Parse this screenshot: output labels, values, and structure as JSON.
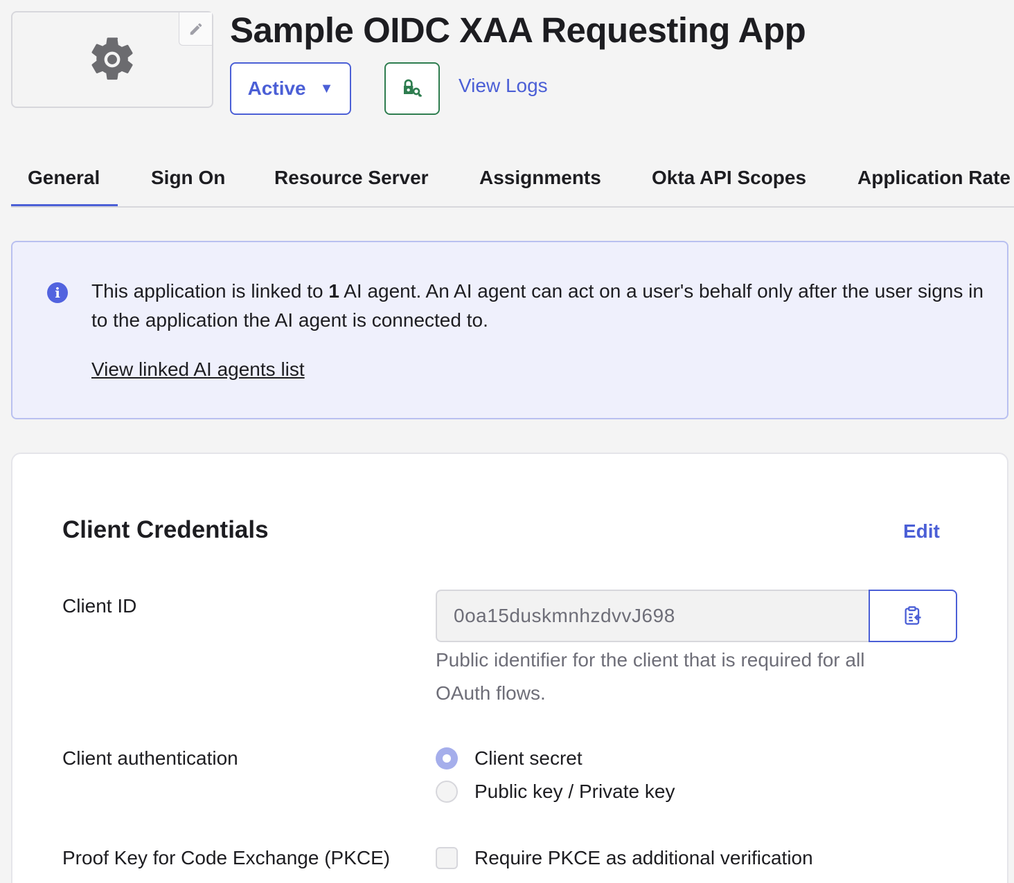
{
  "header": {
    "app_title": "Sample OIDC XAA Requesting App",
    "status_label": "Active",
    "status_caret": "▼",
    "view_logs": "View Logs",
    "logo_icon": "gear-icon",
    "edit_icon": "pencil-icon",
    "key_icon": "lock-key-icon"
  },
  "tabs": [
    {
      "label": "General",
      "active": true
    },
    {
      "label": "Sign On"
    },
    {
      "label": "Resource Server"
    },
    {
      "label": "Assignments"
    },
    {
      "label": "Okta API Scopes"
    },
    {
      "label": "Application Rate"
    }
  ],
  "banner": {
    "text_before": "This application is linked to ",
    "count": "1",
    "text_after": " AI agent. An AI agent can act on a user's behalf only after the user signs in to the application the AI agent is connected to.",
    "link": "View linked AI agents list",
    "icon": "info-icon"
  },
  "credentials": {
    "title": "Client Credentials",
    "edit": "Edit",
    "client_id_label": "Client ID",
    "client_id_value": "0oa15duskmnhzdvvJ698",
    "client_id_hint": "Public identifier for the client that is required for all OAuth flows.",
    "copy_icon": "clipboard-copy-icon",
    "auth_label": "Client authentication",
    "auth_options": [
      {
        "label": "Client secret",
        "selected": true
      },
      {
        "label": "Public key / Private key",
        "selected": false
      }
    ],
    "pkce_label": "Proof Key for Code Exchange (PKCE)",
    "pkce_option": "Require PKCE as additional verification",
    "pkce_checked": false
  },
  "colors": {
    "accent": "#4b5fd6",
    "success": "#2e7d4f",
    "banner_bg": "#eff0fc"
  }
}
